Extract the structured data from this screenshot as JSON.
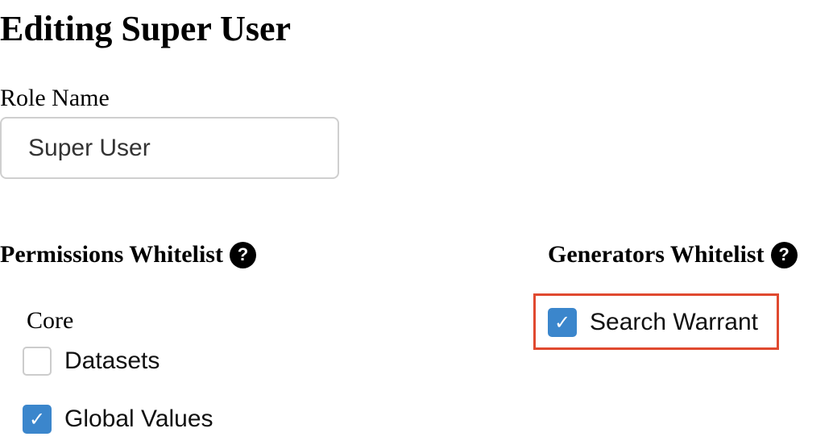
{
  "page": {
    "title": "Editing Super User"
  },
  "role_name": {
    "label": "Role Name",
    "value": "Super User"
  },
  "permissions": {
    "heading": "Permissions Whitelist",
    "help_icon": "question-circle-icon",
    "groups": [
      {
        "label": "Core",
        "items": [
          {
            "label": "Datasets",
            "checked": false
          },
          {
            "label": "Global Values",
            "checked": true
          }
        ]
      }
    ]
  },
  "generators": {
    "heading": "Generators Whitelist",
    "help_icon": "question-circle-icon",
    "items": [
      {
        "label": "Search Warrant",
        "checked": true,
        "highlighted": true
      }
    ]
  },
  "colors": {
    "checkbox_checked": "#3b86cc",
    "highlight_border": "#e0492f",
    "input_border": "#cfcfcf"
  },
  "icons": {
    "help": "?",
    "check": "✓"
  }
}
